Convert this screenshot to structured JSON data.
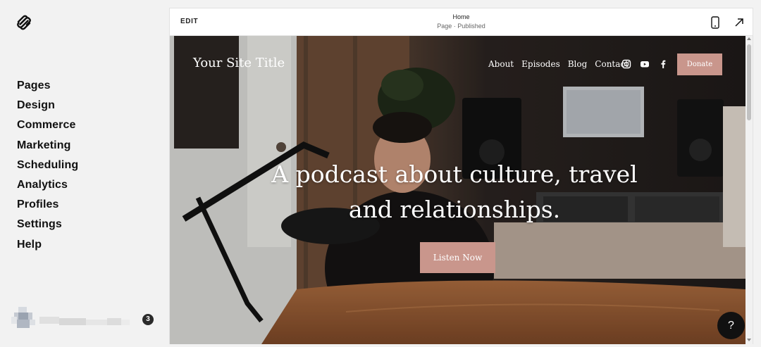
{
  "sidebar": {
    "items": [
      {
        "label": "Pages"
      },
      {
        "label": "Design"
      },
      {
        "label": "Commerce"
      },
      {
        "label": "Marketing"
      },
      {
        "label": "Scheduling"
      },
      {
        "label": "Analytics"
      },
      {
        "label": "Profiles"
      },
      {
        "label": "Settings"
      },
      {
        "label": "Help"
      }
    ],
    "notification_count": "3"
  },
  "topbar": {
    "edit_label": "EDIT",
    "page_title": "Home",
    "page_status": "Page · Published",
    "mobile_icon": "mobile-phone-icon",
    "external_icon": "arrow-up-right-icon"
  },
  "site": {
    "title": "Your Site Title",
    "nav": [
      {
        "label": "About"
      },
      {
        "label": "Episodes"
      },
      {
        "label": "Blog"
      },
      {
        "label": "Contact"
      }
    ],
    "social_icons": [
      "instagram-icon",
      "youtube-icon",
      "facebook-icon"
    ],
    "donate_label": "Donate",
    "hero_heading_line1": "A podcast about culture, travel",
    "hero_heading_line2": "and relationships.",
    "cta_label": "Listen Now"
  },
  "help_label": "?",
  "colors": {
    "accent": "#c9968c",
    "sidebar_bg": "#f2f2f2"
  }
}
